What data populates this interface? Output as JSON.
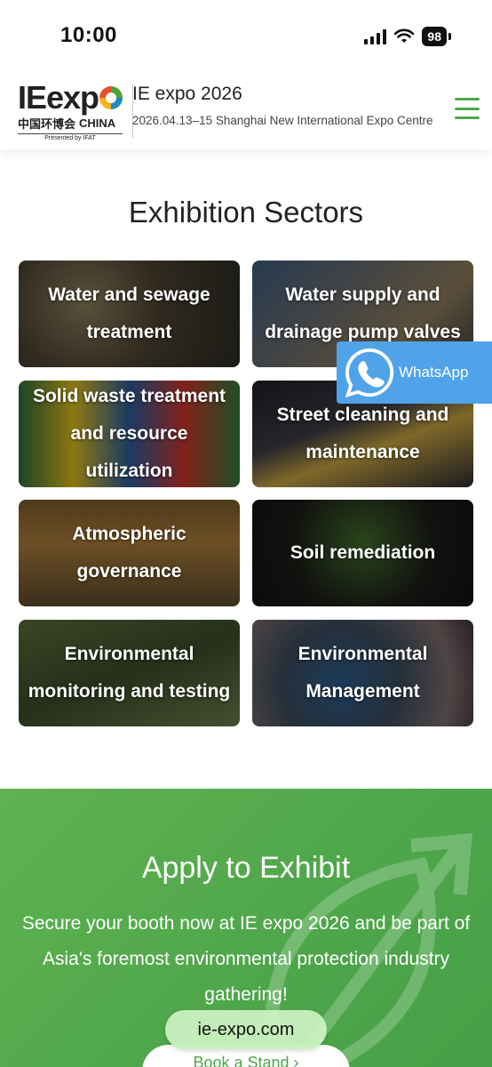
{
  "status_bar": {
    "time": "10:00",
    "battery": "98"
  },
  "header": {
    "logo": {
      "main": "IEexp",
      "cn": "中国环博会",
      "china": "CHINA",
      "presented": "Presented by IFAT"
    },
    "title": "IE expo 2026",
    "subtitle": "2026.04.13–15 Shanghai New International Expo Centre"
  },
  "sectors": {
    "title": "Exhibition Sectors",
    "items": [
      {
        "label": "Water and sewage treatment"
      },
      {
        "label": "Water supply and drainage pump valves"
      },
      {
        "label": "Solid waste treatment and resource utilization"
      },
      {
        "label": "Street cleaning and maintenance"
      },
      {
        "label": "Atmospheric governance"
      },
      {
        "label": "Soil remediation"
      },
      {
        "label": "Environmental monitoring and testing"
      },
      {
        "label": "Environmental Management"
      }
    ]
  },
  "whatsapp": {
    "label": "WhatsApp"
  },
  "apply": {
    "title": "Apply to Exhibit",
    "text": "Secure your booth now at IE expo 2026 and be part of Asia's foremost environmental protection industry gathering!",
    "button": "Book a Stand ›"
  },
  "browser": {
    "url": "ie-expo.com"
  },
  "colors": {
    "brand_green": "#4ea64b",
    "whatsapp_blue": "#50a3e9"
  }
}
